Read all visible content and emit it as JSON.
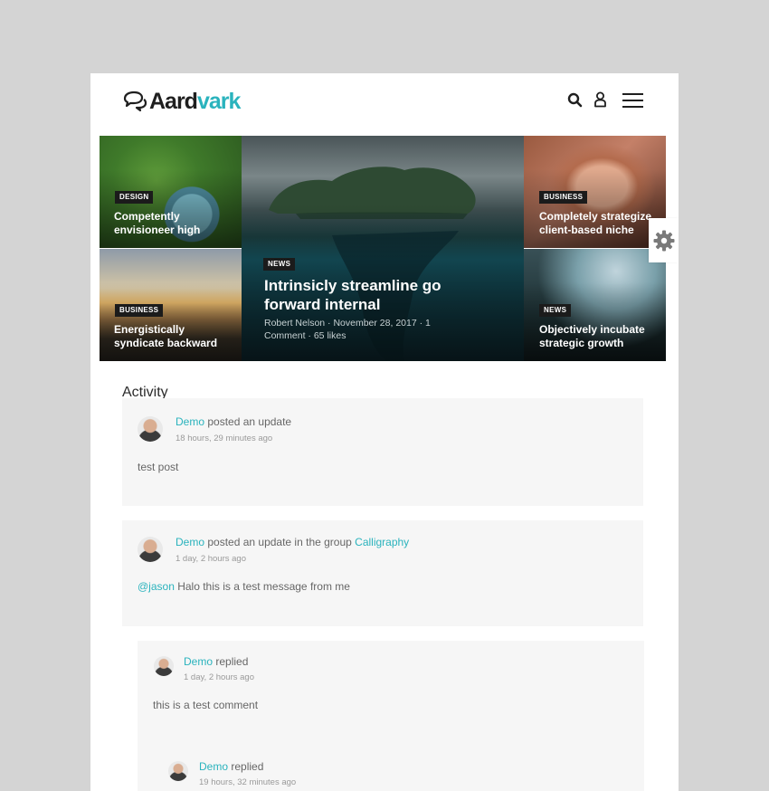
{
  "brand": {
    "part1": "Aard",
    "part2": "vark",
    "accent": "#2ab3bd"
  },
  "header": {
    "icons": [
      "search-icon",
      "user-icon",
      "menu-icon"
    ]
  },
  "hero": {
    "tiles": [
      {
        "badge": "DESIGN",
        "title_line1": "Competently",
        "title_line2": "envisioneer high"
      },
      {
        "badge": "BUSINESS",
        "title_line1": "Energistically",
        "title_line2": "syndicate backward"
      },
      {
        "badge": "NEWS",
        "title_line1": "Intrinsicly streamline go",
        "title_line2": "forward internal",
        "meta_line1": "Robert Nelson · November 28, 2017 · 1",
        "meta_line2": "Comment · 65 likes"
      },
      {
        "badge": "BUSINESS",
        "title_line1": "Completely strategize",
        "title_line2": "client-based niche"
      },
      {
        "badge": "NEWS",
        "title_line1": "Objectively incubate",
        "title_line2": "strategic growth"
      }
    ]
  },
  "activity": {
    "title": "Activity",
    "items": [
      {
        "user": "Demo",
        "action": " posted an update",
        "time": "18 hours, 29 minutes ago",
        "body": "test post"
      },
      {
        "user": "Demo",
        "action": " posted an update in the group ",
        "group": "Calligraphy",
        "time": "1 day, 2 hours ago",
        "mention": "@jason",
        "body": " Halo this is a test message from me"
      },
      {
        "user": "Demo",
        "action": " replied",
        "time": "1 day, 2 hours ago",
        "body": "this is a test comment"
      },
      {
        "user": "Demo",
        "action": " replied",
        "time": "19 hours, 32 minutes ago"
      }
    ]
  }
}
